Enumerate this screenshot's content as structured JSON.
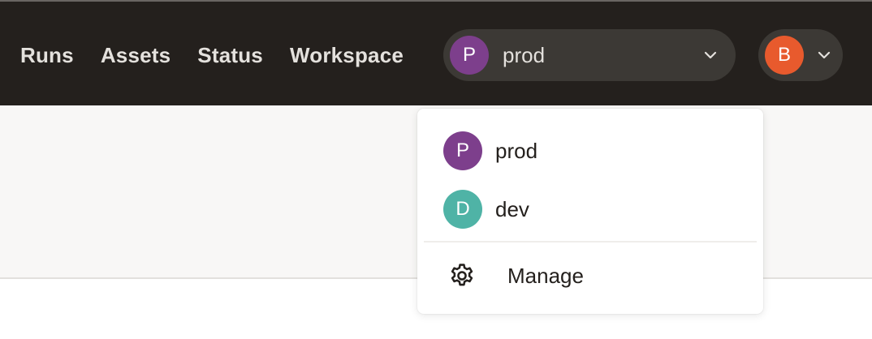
{
  "nav": {
    "items": [
      {
        "label": "Runs"
      },
      {
        "label": "Assets"
      },
      {
        "label": "Status"
      },
      {
        "label": "Workspace"
      }
    ]
  },
  "deployment_selector": {
    "initial": "P",
    "name": "prod",
    "avatar_color": "#7d3f8c",
    "icon": "chevron-down-icon"
  },
  "user_menu": {
    "initial": "B",
    "avatar_color": "#e85a2d",
    "icon": "chevron-down-icon"
  },
  "dropdown": {
    "items": [
      {
        "initial": "P",
        "label": "prod",
        "color": "#7d3f8c"
      },
      {
        "initial": "D",
        "label": "dev",
        "color": "#4fb3a6"
      }
    ],
    "manage": {
      "label": "Manage",
      "icon": "gear-icon"
    }
  }
}
